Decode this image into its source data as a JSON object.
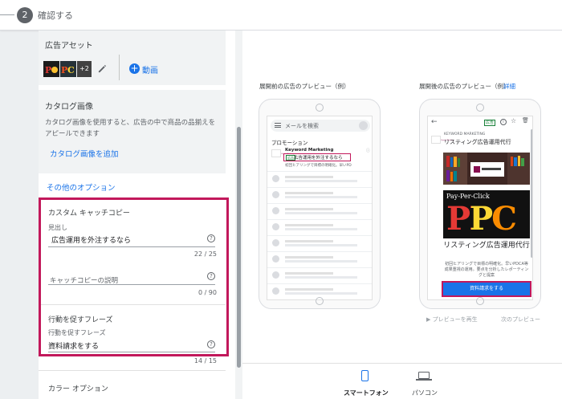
{
  "stepper": {
    "step_number": "2",
    "step_label": "確認する"
  },
  "ad_assets": {
    "title": "広告アセット",
    "image_count_badge": "+2",
    "add_video_label": "動画"
  },
  "catalog": {
    "title": "カタログ画像",
    "description": "カタログ画像を使用すると、広告の中で商品の品揃えをアピールできます",
    "add_link": "カタログ画像を追加"
  },
  "other_options_link": "その他のオプション",
  "custom_catchcopy": {
    "title": "カスタム キャッチコピー",
    "headline_label": "見出し",
    "headline_value": "広告運用を外注するなら",
    "headline_counter": "22 / 25",
    "description_placeholder": "キャッチコピーの説明",
    "description_counter": "0 / 90"
  },
  "cta_phrase": {
    "title": "行動を促すフレーズ",
    "field_label": "行動を促すフレーズ",
    "value": "資料請求をする",
    "counter": "14 / 15"
  },
  "color_options_title": "カラー オプション",
  "preview_collapsed": {
    "label": "展開前の広告のプレビュー（例）",
    "search_placeholder": "メールを検索",
    "promotion_label": "プロモーション",
    "logo_text": "Keyword Marketing",
    "ad_brand": "Keyword Marketing",
    "ad_tag": "広告",
    "ad_headline": "広告運用を外注するなら",
    "ad_desc": "初回ヒアリングで目標の明確化。早いPD"
  },
  "preview_expanded": {
    "label": "展開後の広告のプレビュー（例）",
    "detail_link": "詳細",
    "ad_tag": "広告",
    "company": "KEYWORD MARKETING",
    "brand_line": "リスティング広告運用代行",
    "image_text_top": "Pay-Per-Click",
    "image_text_big": "PPC",
    "title": "リスティング広告運用代行",
    "description": "初回ヒアリングで目標の明確化。早いPDCA等成果重視の運用。要点を分析したレポーティングと提案",
    "cta": "資料請求をする"
  },
  "preview_controls": {
    "play": "プレビューを再生",
    "next": "次のプレビュー"
  },
  "devices": {
    "smartphone": "スマートフォン",
    "pc": "パソコン"
  },
  "colors": {
    "accent": "#1a73e8",
    "highlight": "#c2185b",
    "ad_green": "#188038"
  }
}
